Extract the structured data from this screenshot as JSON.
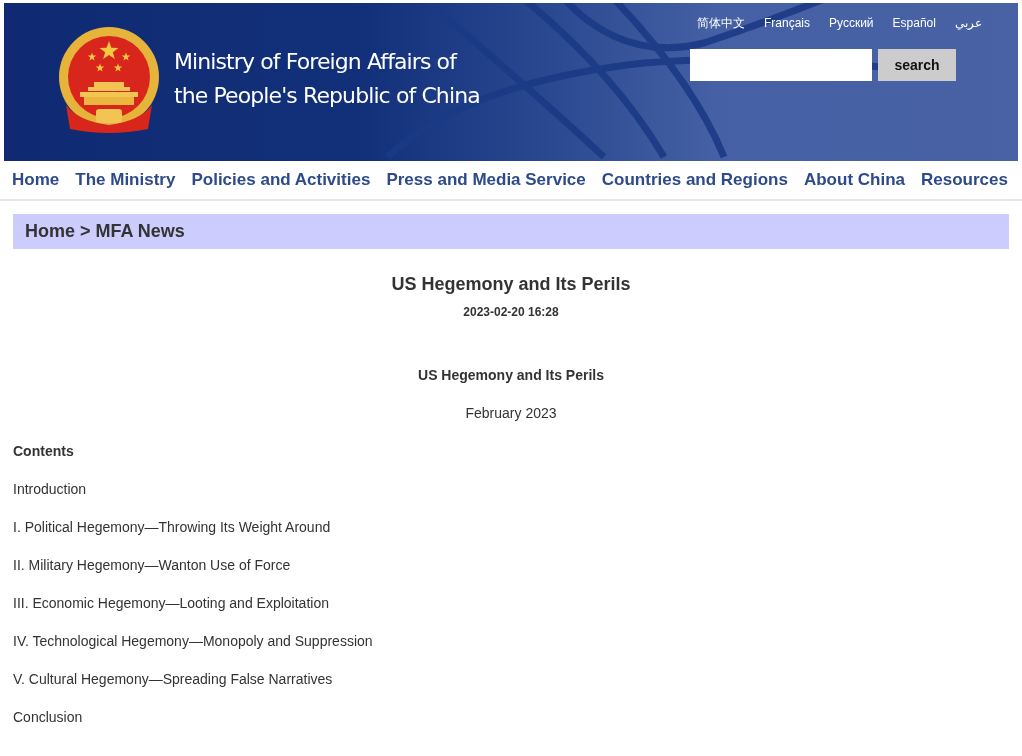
{
  "header": {
    "site_title": [
      "Ministry of Foreign Affairs of",
      "the People's Republic of China"
    ],
    "languages": [
      "简体中文",
      "Français",
      "Русский",
      "Español",
      "عربي"
    ],
    "search": {
      "button": "search"
    }
  },
  "nav": {
    "items": [
      "Home",
      "The Ministry",
      "Policies and Activities",
      "Press and Media Service",
      "Countries and Regions",
      "About China",
      "Resources"
    ]
  },
  "breadcrumb": {
    "items": [
      "Home",
      "MFA News"
    ],
    "separator": ">"
  },
  "article": {
    "title": "US Hegemony and Its Perils",
    "date": "2023-02-20 16:28",
    "subtitle": "US Hegemony and Its Perils",
    "dateline": "February 2023",
    "contents": {
      "heading": "Contents",
      "items": [
        "Introduction",
        "I. Political Hegemony—Throwing Its Weight Around",
        "II. Military Hegemony—Wanton Use of Force",
        "III. Economic Hegemony—Looting and Exploitation",
        "IV. Technological Hegemony—Monopoly and Suppression",
        "V. Cultural Hegemony—Spreading False Narratives",
        "Conclusion"
      ]
    }
  }
}
